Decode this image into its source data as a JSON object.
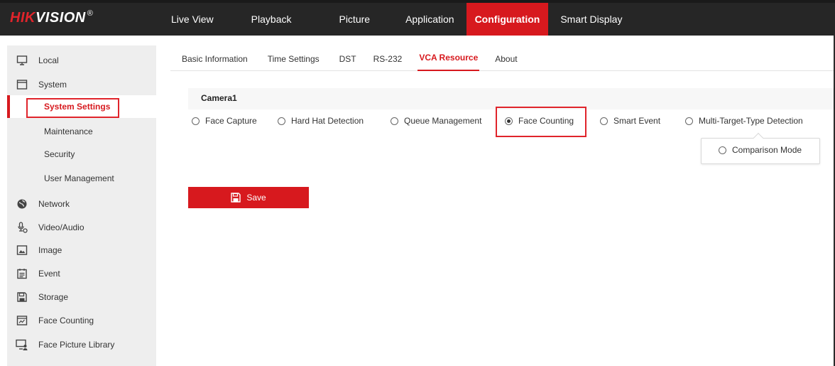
{
  "brand": {
    "name_red": "HIK",
    "name_white": "VISION",
    "reg": "®"
  },
  "nav": [
    {
      "label": "Live View"
    },
    {
      "label": "Playback"
    },
    {
      "label": "Picture"
    },
    {
      "label": "Application"
    },
    {
      "label": "Configuration",
      "active": true
    },
    {
      "label": "Smart Display"
    }
  ],
  "sidebar": {
    "items": [
      {
        "label": "Local",
        "icon": "monitor-icon"
      },
      {
        "label": "System",
        "icon": "system-icon"
      },
      {
        "label": "System Settings",
        "sub": true,
        "active": true
      },
      {
        "label": "Maintenance",
        "sub": true
      },
      {
        "label": "Security",
        "sub": true
      },
      {
        "label": "User Management",
        "sub": true
      },
      {
        "label": "Network",
        "icon": "globe-icon"
      },
      {
        "label": "Video/Audio",
        "icon": "mic-icon"
      },
      {
        "label": "Image",
        "icon": "image-icon"
      },
      {
        "label": "Event",
        "icon": "calendar-icon"
      },
      {
        "label": "Storage",
        "icon": "storage-icon"
      },
      {
        "label": "Face Counting",
        "icon": "face-counting-icon"
      },
      {
        "label": "Face Picture Library",
        "icon": "face-library-icon"
      }
    ]
  },
  "tabs": [
    {
      "label": "Basic Information"
    },
    {
      "label": "Time Settings"
    },
    {
      "label": "DST"
    },
    {
      "label": "RS-232"
    },
    {
      "label": "VCA Resource",
      "active": true
    },
    {
      "label": "About"
    }
  ],
  "camera": {
    "label": "Camera1"
  },
  "resources": [
    {
      "label": "Face Capture",
      "checked": false
    },
    {
      "label": "Hard Hat Detection",
      "checked": false
    },
    {
      "label": "Queue Management",
      "checked": false
    },
    {
      "label": "Face Counting",
      "checked": true
    },
    {
      "label": "Smart Event",
      "checked": false
    },
    {
      "label": "Multi-Target-Type Detection",
      "checked": false
    }
  ],
  "sub_option": {
    "label": "Comparison Mode",
    "checked": false
  },
  "save": {
    "label": "Save",
    "icon": "save-icon"
  },
  "colors": {
    "accent": "#d7191e",
    "topbar": "#262626",
    "sidebar": "#eeeeee"
  }
}
